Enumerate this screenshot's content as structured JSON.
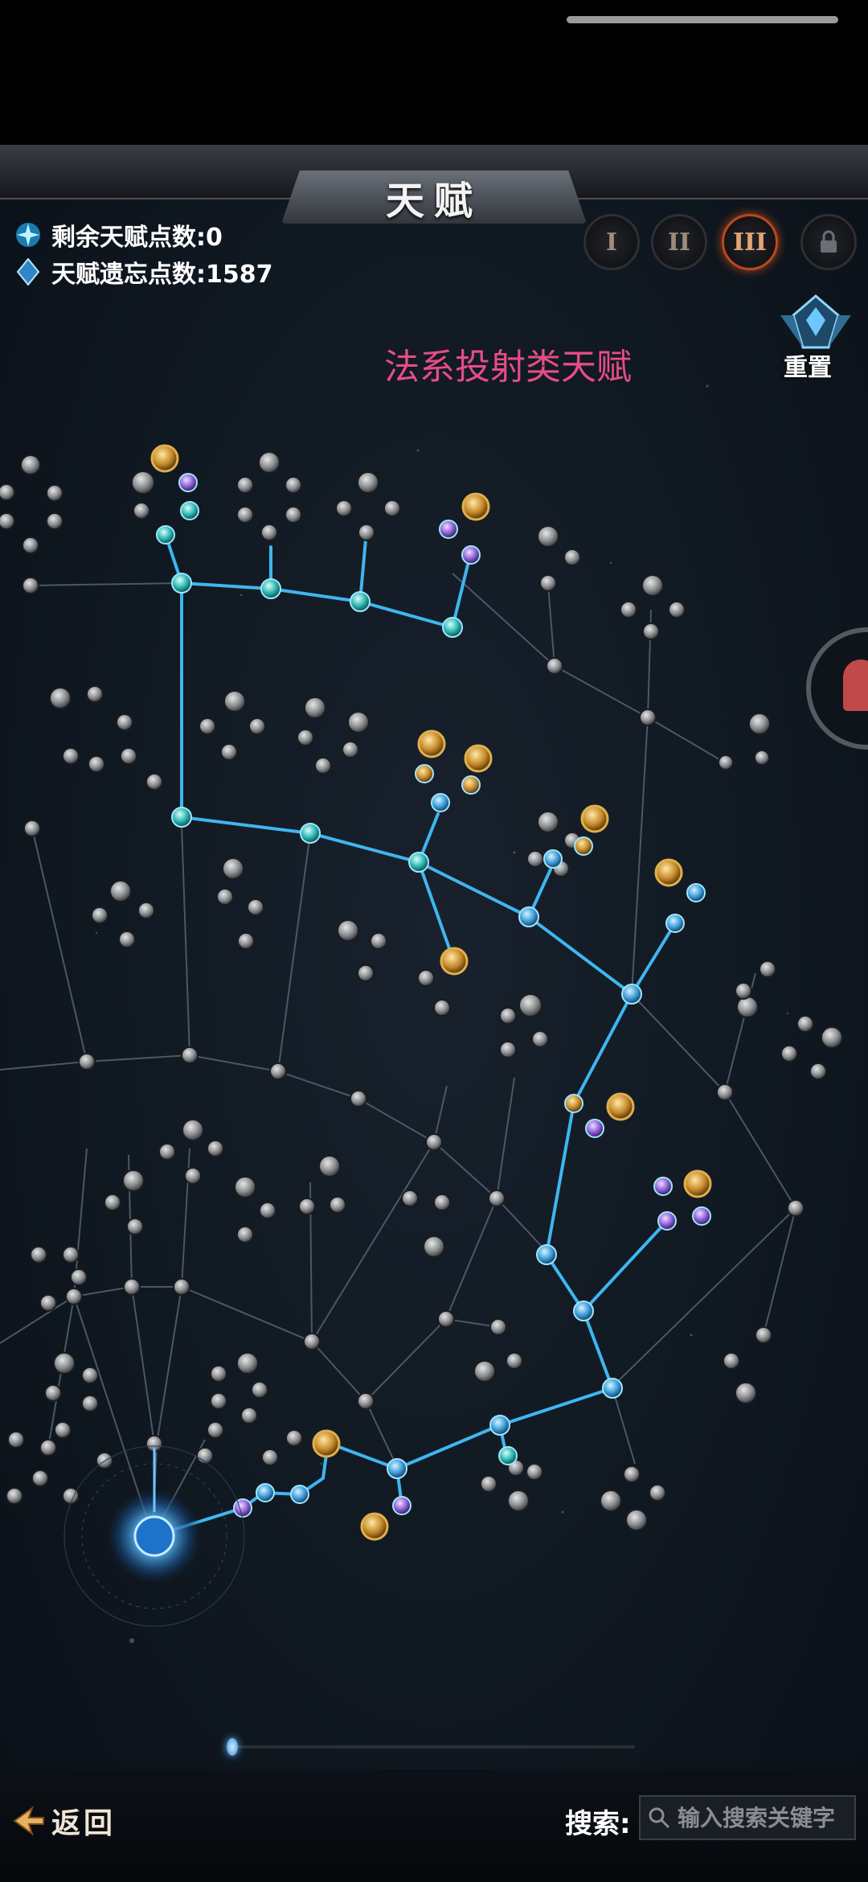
{
  "header": {
    "title": "天赋"
  },
  "stats": {
    "remaining_points_label": "剩余天赋点数:0",
    "forget_points_label": "天赋遗忘点数:1587"
  },
  "tiers": [
    {
      "label": "I",
      "active": false
    },
    {
      "label": "II",
      "active": false
    },
    {
      "label": "III",
      "active": true
    },
    {
      "label": "locked-icon",
      "active": false
    }
  ],
  "reset": {
    "label": "重置"
  },
  "tree": {
    "caption": "法系投射类天赋"
  },
  "footer": {
    "back_label": "返回",
    "search_label": "搜索:",
    "search_placeholder": "输入搜索关键字"
  },
  "colors": {
    "active_path": "#3fb6f0",
    "inactive_path": "#4a5866",
    "caption": "#e54d86",
    "active_tier": "#b84a1d"
  }
}
